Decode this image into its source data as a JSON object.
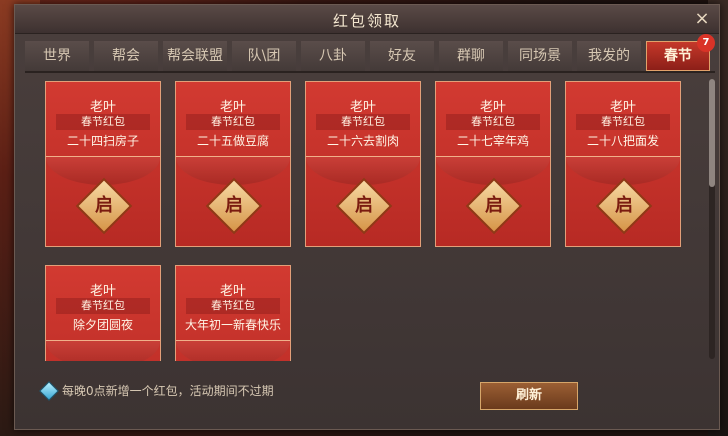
{
  "window": {
    "title": "红包领取",
    "close_icon": "×"
  },
  "tabs": [
    {
      "label": "世界"
    },
    {
      "label": "帮会"
    },
    {
      "label": "帮会联盟"
    },
    {
      "label": "队\\团"
    },
    {
      "label": "八卦"
    },
    {
      "label": "好友"
    },
    {
      "label": "群聊"
    },
    {
      "label": "同场景"
    },
    {
      "label": "我发的"
    },
    {
      "label": "春节",
      "active": true,
      "badge": "7"
    }
  ],
  "cards": [
    {
      "name": "老叶",
      "type": "春节红包",
      "message": "二十四扫房子",
      "seal": "启"
    },
    {
      "name": "老叶",
      "type": "春节红包",
      "message": "二十五做豆腐",
      "seal": "启"
    },
    {
      "name": "老叶",
      "type": "春节红包",
      "message": "二十六去割肉",
      "seal": "启"
    },
    {
      "name": "老叶",
      "type": "春节红包",
      "message": "二十七宰年鸡",
      "seal": "启"
    },
    {
      "name": "老叶",
      "type": "春节红包",
      "message": "二十八把面发",
      "seal": "启"
    },
    {
      "name": "老叶",
      "type": "春节红包",
      "message": "除夕团圆夜",
      "seal": ""
    },
    {
      "name": "老叶",
      "type": "春节红包",
      "message": "大年初一新春快乐",
      "seal": ""
    }
  ],
  "footer": {
    "note": "每晚0点新增一个红包，活动期间不过期",
    "refresh_label": "刷新"
  },
  "colors": {
    "accent": "#c5382a",
    "card_red": "#d23a31",
    "seal_gold": "#e6b06e"
  }
}
